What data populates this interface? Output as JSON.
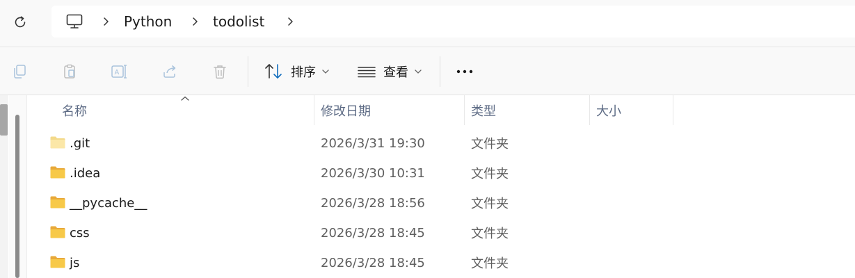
{
  "breadcrumb": {
    "items": [
      "Python",
      "todolist"
    ]
  },
  "toolbar": {
    "sort_label": "排序",
    "view_label": "查看"
  },
  "columns": {
    "name": "名称",
    "modified": "修改日期",
    "type": "类型",
    "size": "大小"
  },
  "files": [
    {
      "name": ".git",
      "modified": "2026/3/31 19:30",
      "type": "文件夹"
    },
    {
      "name": ".idea",
      "modified": "2026/3/30 10:31",
      "type": "文件夹"
    },
    {
      "name": "__pycache__",
      "modified": "2026/3/28 18:56",
      "type": "文件夹"
    },
    {
      "name": "css",
      "modified": "2026/3/28 18:45",
      "type": "文件夹"
    },
    {
      "name": "js",
      "modified": "2026/3/28 18:45",
      "type": "文件夹"
    }
  ],
  "colors": {
    "folder": "#f7c948",
    "folder_dark": "#e8a93a",
    "accent": "#0f6cbd"
  }
}
